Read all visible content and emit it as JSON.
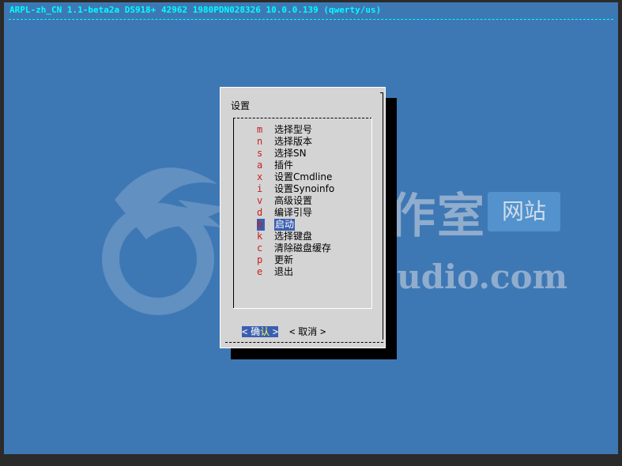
{
  "backtitle": "ARPL-zh_CN 1.1-beta2a DS918+ 42962 1980PDN028326 10.0.0.139 (qwerty/us)",
  "watermark": {
    "cn": "腾龙工作室",
    "badge": "网站",
    "en": "Tenlonstudio.com"
  },
  "dialog": {
    "title": "设置",
    "items": [
      {
        "key": "m",
        "label": "选择型号"
      },
      {
        "key": "n",
        "label": "选择版本"
      },
      {
        "key": "s",
        "label": "选择SN"
      },
      {
        "key": "a",
        "label": "插件"
      },
      {
        "key": "x",
        "label": "设置Cmdline"
      },
      {
        "key": "i",
        "label": "设置Synoinfo"
      },
      {
        "key": "v",
        "label": "高级设置"
      },
      {
        "key": "d",
        "label": "编译引导"
      },
      {
        "key": "b",
        "label": "启动"
      },
      {
        "key": "k",
        "label": "选择键盘"
      },
      {
        "key": "c",
        "label": "清除磁盘缓存"
      },
      {
        "key": "p",
        "label": "更新"
      },
      {
        "key": "e",
        "label": "退出"
      }
    ],
    "selected_key": "b",
    "buttons": {
      "ok_left": "<",
      "ok_label_first": "确",
      "ok_label_hot": "认",
      "ok_right": ">",
      "cancel_left": "<",
      "cancel_label": "取消",
      "cancel_right": ">"
    }
  },
  "colors": {
    "screen_bg": "#3e78b4",
    "backtitle": "#00ffff",
    "dialog_bg": "#d4d4d4",
    "hotkey": "#c81e1e",
    "selection": "#3a5fb0"
  }
}
